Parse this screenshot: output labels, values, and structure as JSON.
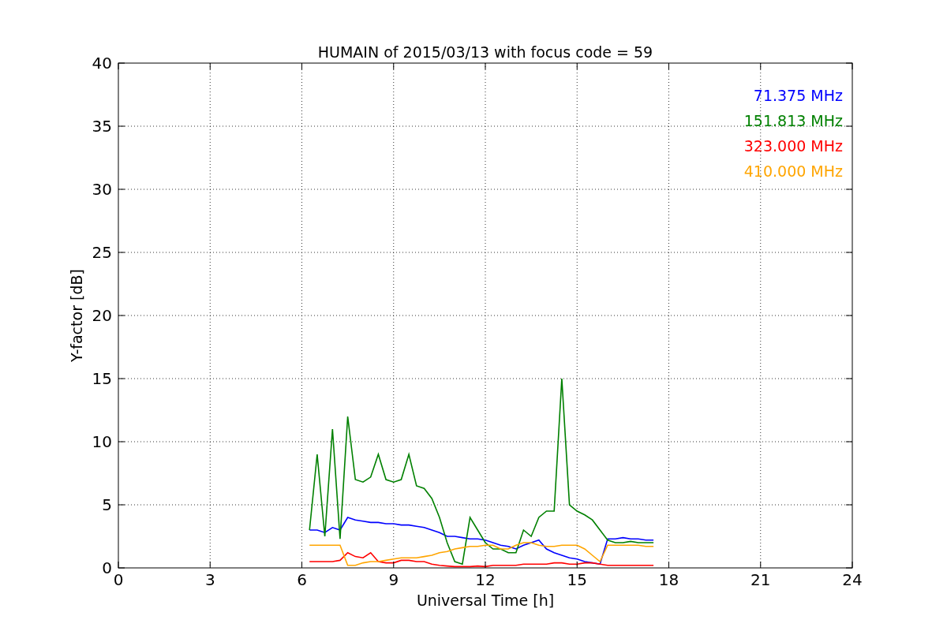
{
  "chart_data": {
    "type": "line",
    "title": "HUMAIN of 2015/03/13 with focus code = 59",
    "xlabel": "Universal Time [h]",
    "ylabel": "Y-factor [dB]",
    "x": [
      6.25,
      6.5,
      6.75,
      7,
      7.25,
      7.5,
      7.75,
      8,
      8.25,
      8.5,
      8.75,
      9,
      9.25,
      9.5,
      9.75,
      10,
      10.25,
      10.5,
      10.75,
      11,
      11.25,
      11.5,
      11.75,
      12,
      12.25,
      12.5,
      12.75,
      13,
      13.25,
      13.5,
      13.75,
      14,
      14.25,
      14.5,
      14.75,
      15,
      15.25,
      15.5,
      15.75,
      16,
      16.25,
      16.5,
      16.75,
      17,
      17.25,
      17.5
    ],
    "series": [
      {
        "name": "71.375 MHz",
        "color": "#0000ff",
        "values": [
          3,
          3,
          2.8,
          3.2,
          3,
          4,
          3.8,
          3.7,
          3.6,
          3.6,
          3.5,
          3.5,
          3.4,
          3.4,
          3.3,
          3.2,
          3,
          2.8,
          2.5,
          2.5,
          2.4,
          2.3,
          2.3,
          2.2,
          2,
          1.8,
          1.7,
          1.5,
          1.8,
          2,
          2.2,
          1.5,
          1.2,
          1,
          0.8,
          0.7,
          0.5,
          0.4,
          0.3,
          2.3,
          2.3,
          2.4,
          2.3,
          2.3,
          2.2,
          2.2
        ]
      },
      {
        "name": "151.813 MHz",
        "color": "#008000",
        "values": [
          3,
          9,
          2.5,
          11,
          2.3,
          12,
          7,
          6.8,
          7.2,
          9,
          7,
          6.8,
          7,
          9,
          6.5,
          6.3,
          5.5,
          4,
          2,
          0.5,
          0.3,
          4,
          3,
          2,
          1.5,
          1.5,
          1.2,
          1.2,
          3,
          2.5,
          4,
          4.5,
          4.5,
          15,
          5,
          4.5,
          4.2,
          3.8,
          3,
          2.2,
          2,
          2,
          2.1,
          2,
          2,
          2
        ]
      },
      {
        "name": "323.000 MHz",
        "color": "#ff0000",
        "values": [
          0.5,
          0.5,
          0.5,
          0.5,
          0.6,
          1.2,
          0.9,
          0.8,
          1.2,
          0.5,
          0.4,
          0.4,
          0.6,
          0.6,
          0.5,
          0.5,
          0.3,
          0.2,
          0.15,
          0.1,
          0.1,
          0.1,
          0.15,
          0.1,
          0.2,
          0.2,
          0.2,
          0.2,
          0.3,
          0.3,
          0.3,
          0.3,
          0.4,
          0.4,
          0.3,
          0.3,
          0.4,
          0.4,
          0.3,
          0.2,
          0.2,
          0.2,
          0.2,
          0.2,
          0.2,
          0.2
        ]
      },
      {
        "name": "410.000 MHz",
        "color": "#ffa500",
        "values": [
          1.8,
          1.8,
          1.8,
          1.8,
          1.8,
          0.2,
          0.2,
          0.4,
          0.5,
          0.5,
          0.6,
          0.7,
          0.8,
          0.8,
          0.8,
          0.9,
          1,
          1.2,
          1.3,
          1.5,
          1.6,
          1.7,
          1.7,
          1.8,
          1.8,
          1.5,
          1.5,
          1.8,
          2,
          2,
          1.8,
          1.7,
          1.7,
          1.8,
          1.8,
          1.8,
          1.5,
          1,
          0.5,
          1.8,
          1.8,
          1.8,
          1.8,
          1.8,
          1.7,
          1.7
        ]
      }
    ],
    "xlim": [
      0,
      24
    ],
    "ylim": [
      0,
      40
    ],
    "xticks": [
      0,
      3,
      6,
      9,
      12,
      15,
      18,
      21,
      24
    ],
    "yticks": [
      0,
      5,
      10,
      15,
      20,
      25,
      30,
      35,
      40
    ],
    "grid": true
  }
}
